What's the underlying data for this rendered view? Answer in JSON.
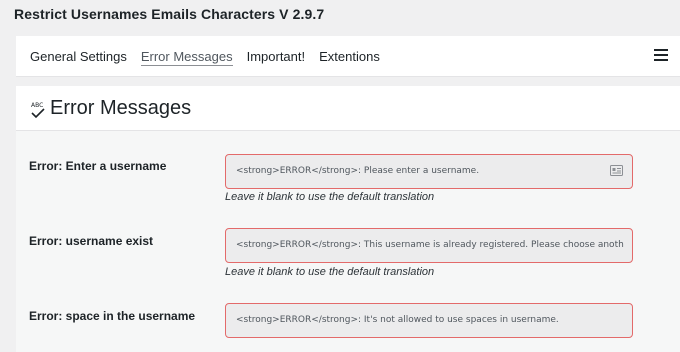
{
  "plugin": {
    "title": "Restrict Usernames Emails Characters V 2.9.7"
  },
  "nav": {
    "tabs": [
      {
        "label": "General Settings"
      },
      {
        "label": "Error Messages"
      },
      {
        "label": "Important!"
      },
      {
        "label": "Extentions"
      }
    ],
    "active_tab": "Error Messages",
    "menu_icon": "hamburger-icon"
  },
  "panel": {
    "icon": "abc-check-icon",
    "title": "Error Messages"
  },
  "fields": [
    {
      "label": "Error: Enter a username",
      "value": "<strong>ERROR</strong>: Please enter a username.",
      "hint": "Leave it blank to use the default translation",
      "icon": "contact-card-icon"
    },
    {
      "label": "Error: username exist",
      "value": "<strong>ERROR</strong>: This username is already registered. Please choose anoth",
      "hint": "Leave it blank to use the default translation"
    },
    {
      "label": "Error: space in the username",
      "value": "<strong>ERROR</strong>: It's not allowed to use spaces in username."
    }
  ],
  "colors": {
    "field_border": "#e36a6a",
    "field_background": "#ececed",
    "page_background": "#f0f0f1"
  }
}
